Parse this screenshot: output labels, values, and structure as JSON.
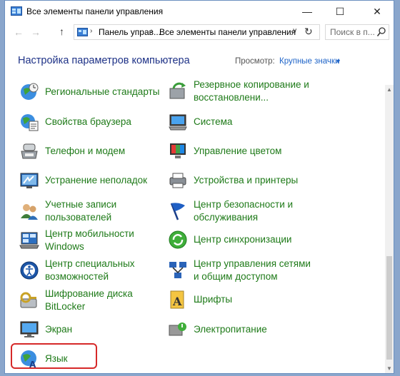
{
  "window": {
    "title": "Все элементы панели управления",
    "minimize_glyph": "—",
    "maximize_glyph": "☐",
    "close_glyph": "✕"
  },
  "nav": {
    "back_glyph": "←",
    "forward_glyph": "→",
    "up_glyph": "↑",
    "breadcrumb": [
      "Панель управ...",
      "Все элементы панели управления"
    ],
    "chevron_glyph": "›",
    "dropdown_glyph": "∨",
    "refresh_glyph": "↻",
    "search_placeholder": "Поиск в п..."
  },
  "header": {
    "title": "Настройка параметров компьютера",
    "view_label": "Просмотр:",
    "view_value": "Крупные значки",
    "view_arrow": "▼"
  },
  "items_left": [
    {
      "label": "Региональные стандарты",
      "icon": "globe-clock-icon"
    },
    {
      "label": "Свойства браузера",
      "icon": "internet-options-icon"
    },
    {
      "label": "Телефон и модем",
      "icon": "phone-modem-icon"
    },
    {
      "label": "Устранение неполадок",
      "icon": "troubleshooting-icon"
    },
    {
      "label": "Учетные записи\nпользователей",
      "icon": "user-accounts-icon"
    },
    {
      "label": "Центр мобильности\nWindows",
      "icon": "mobility-center-icon"
    },
    {
      "label": "Центр специальных\nвозможностей",
      "icon": "ease-of-access-icon"
    },
    {
      "label": "Шифрование диска\nBitLocker",
      "icon": "bitlocker-icon"
    },
    {
      "label": "Экран",
      "icon": "display-icon"
    },
    {
      "label": "Язык",
      "icon": "language-icon"
    }
  ],
  "items_right": [
    {
      "label": "Резервное копирование и\nвосстановлени...",
      "icon": "backup-restore-icon"
    },
    {
      "label": "Система",
      "icon": "system-icon"
    },
    {
      "label": "Управление цветом",
      "icon": "color-management-icon"
    },
    {
      "label": "Устройства и принтеры",
      "icon": "devices-printers-icon"
    },
    {
      "label": "Центр безопасности и\nобслуживания",
      "icon": "security-flag-icon"
    },
    {
      "label": "Центр синхронизации",
      "icon": "sync-center-icon"
    },
    {
      "label": "Центр управления сетями\nи общим доступом",
      "icon": "network-center-icon"
    },
    {
      "label": "Шрифты",
      "icon": "fonts-icon"
    },
    {
      "label": "Электропитание",
      "icon": "power-options-icon"
    }
  ],
  "scroll": {
    "up_glyph": "▲",
    "down_glyph": "▼"
  },
  "colors": {
    "link_green": "#1e7a18",
    "heading_blue": "#1e3287",
    "accent_blue": "#1e64c8",
    "highlight_red": "#d62929"
  }
}
